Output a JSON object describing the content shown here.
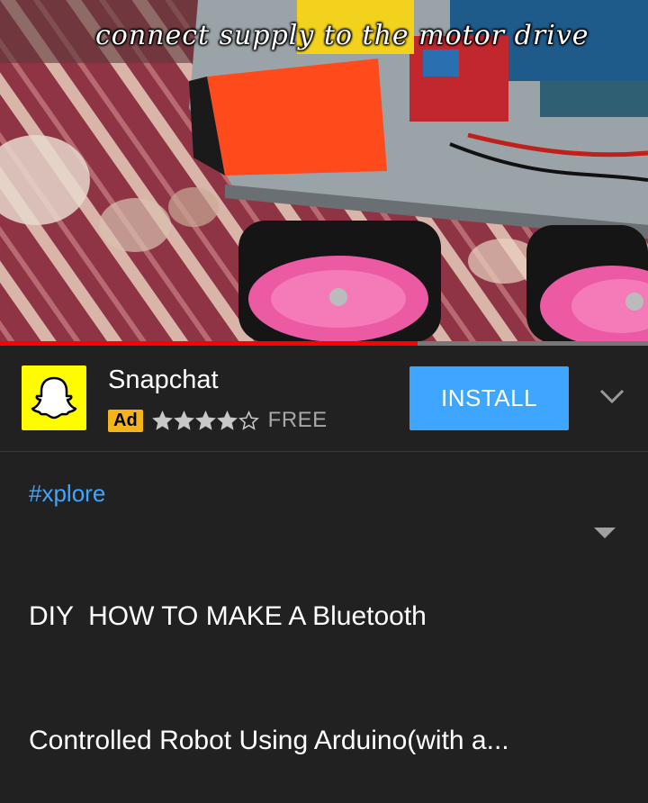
{
  "video": {
    "caption": "connect supply to the motor drive",
    "progress_fraction": 0.645
  },
  "ad": {
    "app_name": "Snapchat",
    "badge": "Ad",
    "rating_stars": 4,
    "rating_max": 5,
    "price": "FREE",
    "install_label": "INSTALL",
    "logo_icon": "snapchat-ghost-icon",
    "expand_icon": "chevron-down-icon"
  },
  "info": {
    "hashtag": "#xplore",
    "title_line1": "DIY  HOW TO MAKE A Bluetooth",
    "title_line2": "Controlled Robot Using Arduino(with a...",
    "expand_icon": "caret-down-icon"
  },
  "colors": {
    "background": "#212121",
    "accent_blue": "#3ea6ff",
    "progress_red": "#ff0000",
    "ad_badge": "#f3b51a",
    "snapchat_yellow": "#fffc00"
  }
}
